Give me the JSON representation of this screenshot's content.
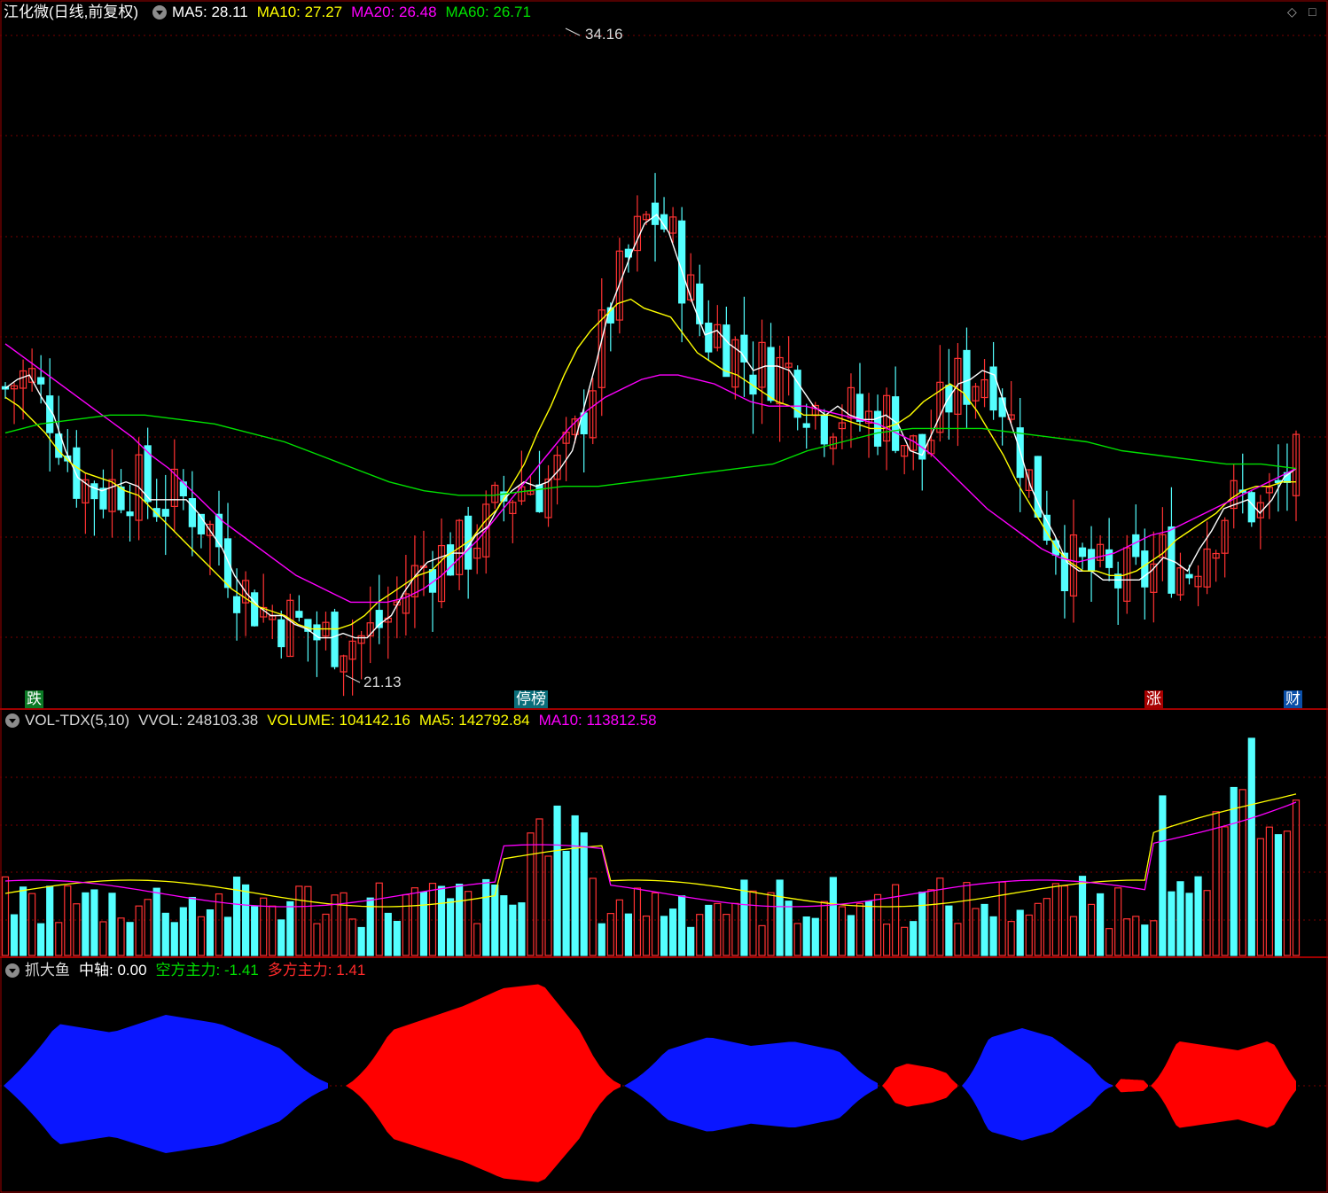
{
  "header": {
    "stock_title": "江化微(日线,前复权)",
    "ma5": "MA5: 28.11",
    "ma10": "MA10: 27.27",
    "ma20": "MA20: 26.48",
    "ma60": "MA60: 26.71"
  },
  "vol_header": {
    "name": "VOL-TDX(5,10)",
    "vvol": "VVOL: 248103.38",
    "volume": "VOLUME: 104142.16",
    "ma5": "MA5: 142792.84",
    "ma10": "MA10: 113812.58"
  },
  "ind_header": {
    "name": "抓大鱼",
    "axis": "中轴: 0.00",
    "bear": "空方主力: -1.41",
    "bull": "多方主力: 1.41"
  },
  "annotations": {
    "high_label": "34.16",
    "low_label": "21.13",
    "tag_fall": "跌",
    "tag_stop": "停榜",
    "tag_rise": "涨",
    "tag_fin": "财"
  },
  "icons": [
    "diamond-icon",
    "maximize-icon",
    "dropdown-circle-icon"
  ],
  "colors": {
    "up": "#ff3232",
    "down": "#54ffff",
    "ma5": "#ffffff",
    "ma10": "#ffff00",
    "ma20": "#ff00ff",
    "ma60": "#00e000",
    "bull_fill": "#ff0000",
    "bear_fill": "#0a16ff",
    "grid": "#7a0000"
  },
  "chart_data": [
    {
      "type": "candlestick",
      "ylim": [
        20.2,
        35.2
      ],
      "grid": true,
      "series": [
        {
          "name": "MA5",
          "values": [
            27.2,
            27.4,
            27.5,
            27.0,
            26.6,
            25.8,
            25.2,
            25.0,
            24.9,
            25.0,
            25.1,
            25.0,
            24.7,
            24.7,
            24.7,
            24.7,
            24.4,
            24.0,
            23.6,
            23.0,
            22.6,
            22.3,
            22.1,
            22.1,
            21.9,
            21.8,
            21.6,
            21.6,
            21.7,
            21.6,
            21.6,
            21.9,
            22.1,
            22.6,
            23.0,
            23.3,
            23.4,
            23.5,
            23.5,
            23.9,
            24.1,
            24.6,
            24.9,
            25.1,
            25.0,
            25.1,
            25.4,
            25.8,
            26.8,
            27.8,
            28.9,
            29.6,
            30.3,
            30.9,
            31.1,
            30.7,
            29.9,
            29.1,
            28.4,
            28.5,
            28.2,
            28.0,
            27.6,
            27.7,
            27.7,
            27.6,
            27.2,
            26.8,
            26.6,
            26.8,
            26.6,
            26.5,
            26.5,
            26.6,
            26.4,
            25.8,
            25.7,
            26.3,
            26.9,
            27.3,
            27.4,
            27.6,
            27.5,
            26.7,
            25.9,
            25.0,
            24.4,
            23.9,
            23.3,
            23.1,
            23.1,
            22.9,
            22.9,
            22.9,
            22.9,
            23.1,
            23.4,
            23.3,
            23.1,
            23.6,
            24.0,
            24.5,
            24.6,
            24.7,
            24.4,
            24.7,
            25.2,
            25.4
          ]
        },
        {
          "name": "MA10",
          "values": [
            27.0,
            26.8,
            26.5,
            26.2,
            25.8,
            25.5,
            25.3,
            25.2,
            25.1,
            24.9,
            24.8,
            24.5,
            24.2,
            23.9,
            23.6,
            23.3,
            23.0,
            22.7,
            22.5,
            22.3,
            22.2,
            22.1,
            21.9,
            21.8,
            21.8,
            21.8,
            21.9,
            22.1,
            22.4,
            22.6,
            22.8,
            23.0,
            23.1,
            23.4,
            23.6,
            23.8,
            24.2,
            24.5,
            25.0,
            25.5,
            26.2,
            26.8,
            27.5,
            28.1,
            28.5,
            28.8,
            29.1,
            29.2,
            29.0,
            28.9,
            28.8,
            28.4,
            28.0,
            27.8,
            27.6,
            27.5,
            27.3,
            27.1,
            26.9,
            26.8,
            26.6,
            26.6,
            26.6,
            26.5,
            26.4,
            26.3,
            26.3,
            26.4,
            26.6,
            26.9,
            27.1,
            27.3,
            27.1,
            26.7,
            26.2,
            25.7,
            25.1,
            24.6,
            24.1,
            23.6,
            23.3,
            23.1,
            23.1,
            23.0,
            23.0,
            23.1,
            23.3,
            23.5,
            23.8,
            24.0,
            24.2,
            24.4,
            24.7,
            24.9,
            25.0,
            25.0,
            25.1,
            25.1
          ]
        },
        {
          "name": "MA20",
          "values": [
            28.2,
            27.9,
            27.6,
            27.3,
            27.0,
            26.7,
            26.4,
            26.1,
            25.7,
            25.4,
            25.0,
            24.6,
            24.2,
            23.9,
            23.6,
            23.3,
            23.0,
            22.8,
            22.6,
            22.4,
            22.4,
            22.4,
            22.5,
            22.7,
            23.0,
            23.4,
            23.8,
            24.3,
            24.8,
            25.3,
            25.8,
            26.3,
            26.7,
            27.0,
            27.2,
            27.4,
            27.5,
            27.5,
            27.4,
            27.3,
            27.1,
            26.9,
            26.8,
            26.8,
            26.8,
            26.7,
            26.6,
            26.5,
            26.4,
            26.2,
            26.0,
            25.7,
            25.3,
            24.9,
            24.5,
            24.2,
            23.9,
            23.6,
            23.4,
            23.3,
            23.4,
            23.5,
            23.7,
            23.9,
            24.0,
            24.2,
            24.4,
            24.6,
            24.8,
            25.0,
            25.2,
            25.4
          ]
        },
        {
          "name": "MA60",
          "values": [
            26.2,
            26.4,
            26.5,
            26.6,
            26.6,
            26.5,
            26.4,
            26.2,
            26.0,
            25.7,
            25.4,
            25.1,
            24.9,
            24.8,
            24.8,
            24.9,
            25.0,
            25.0,
            25.1,
            25.2,
            25.3,
            25.4,
            25.5,
            25.8,
            26.0,
            26.2,
            26.3,
            26.3,
            26.3,
            26.2,
            26.1,
            26.0,
            25.8,
            25.7,
            25.6,
            25.5,
            25.5,
            25.4
          ]
        }
      ]
    },
    {
      "type": "bar",
      "series": [
        {
          "name": "VOLUME"
        },
        {
          "name": "MA5"
        },
        {
          "name": "MA10"
        }
      ]
    },
    {
      "type": "area",
      "x_axis": "中轴",
      "series": [
        {
          "name": "多方主力"
        },
        {
          "name": "空方主力"
        }
      ]
    }
  ]
}
